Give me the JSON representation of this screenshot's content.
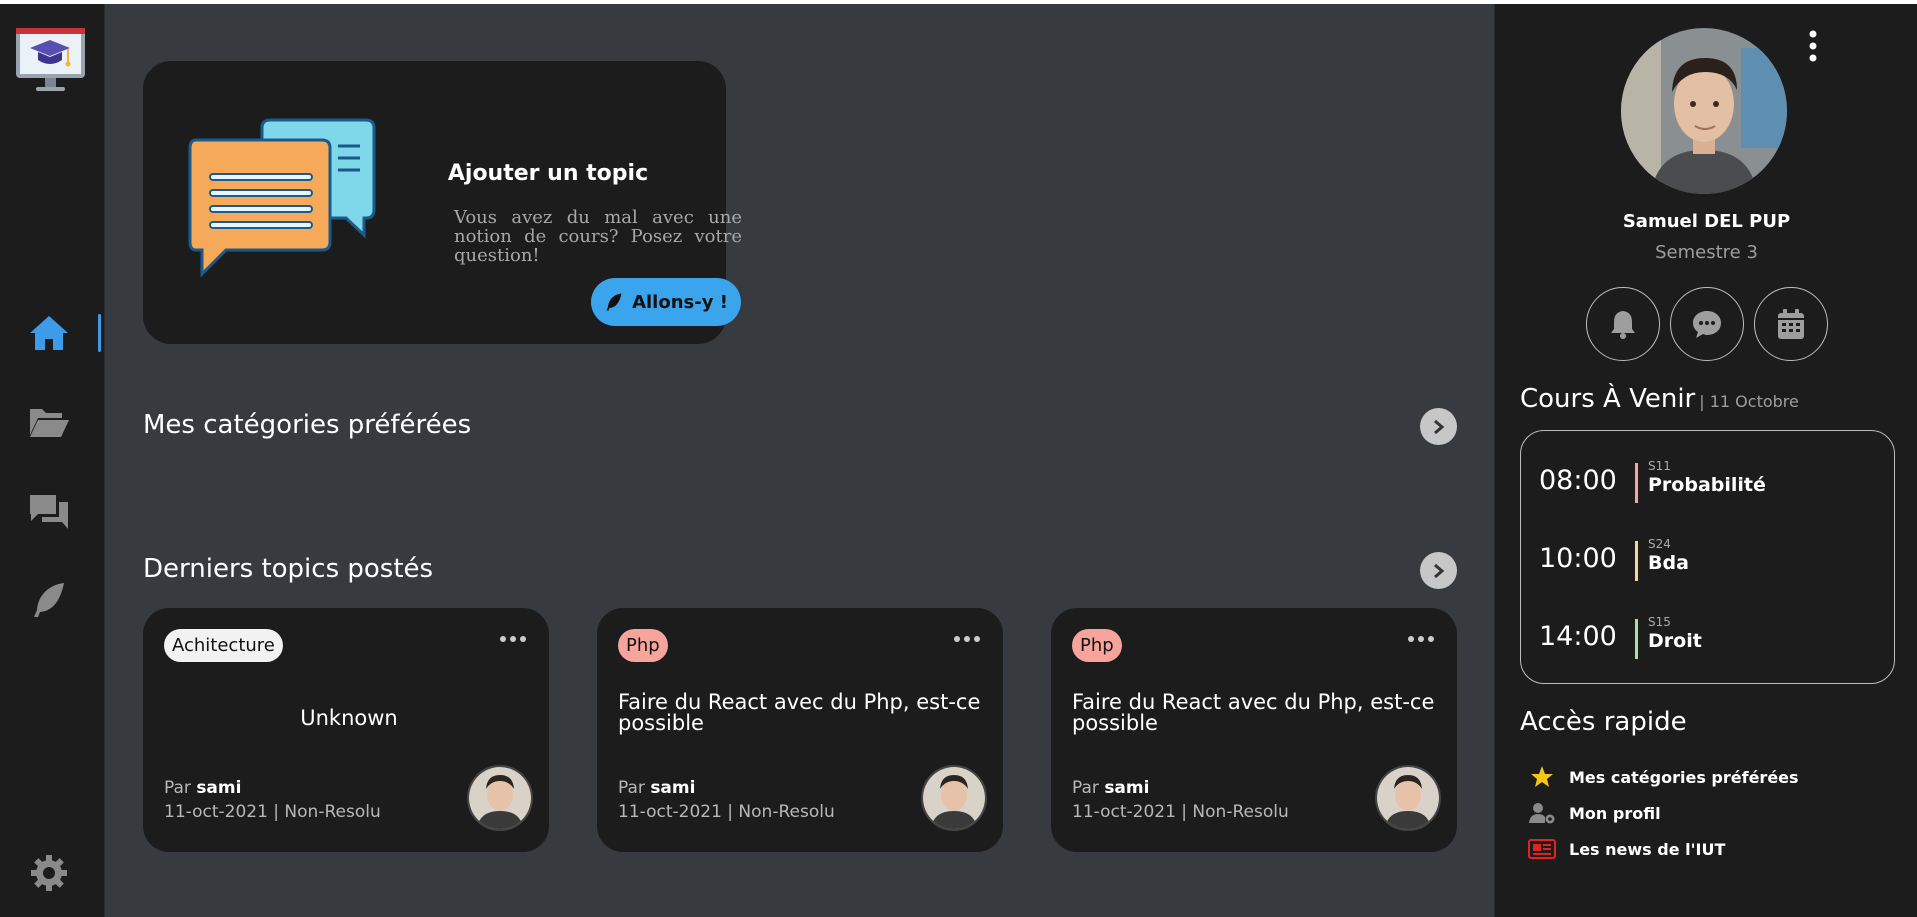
{
  "add_topic": {
    "title": "Ajouter un topic",
    "description": "Vous avez du mal avec une notion de cours? Posez votre question!",
    "button_label": "Allons-y !"
  },
  "sections": {
    "favorites": "Mes catégories préférées",
    "latest": "Derniers topics postés"
  },
  "topics": [
    {
      "tag": "Achitecture",
      "tag_color": "#f2f2f2",
      "title": "Unknown",
      "by_prefix": "Par",
      "author": "sami",
      "info": "11-oct-2021 | Non-Resolu"
    },
    {
      "tag": "Php",
      "tag_color": "#f6a49c",
      "title": "Faire du React avec du Php, est-ce possible",
      "by_prefix": "Par",
      "author": "sami",
      "info": "11-oct-2021 | Non-Resolu"
    },
    {
      "tag": "Php",
      "tag_color": "#f6a49c",
      "title": "Faire du React avec du Php, est-ce possible",
      "by_prefix": "Par",
      "author": "sami",
      "info": "11-oct-2021 | Non-Resolu"
    }
  ],
  "profile": {
    "name": "Samuel DEL PUP",
    "semester": "Semestre 3"
  },
  "courses": {
    "title": "Cours À Venir",
    "date": "| 11 Octobre",
    "items": [
      {
        "time": "08:00",
        "room": "S11",
        "name": "Probabilité",
        "color": "#f4a7a0"
      },
      {
        "time": "10:00",
        "room": "S24",
        "name": "Bda",
        "color": "#f4d7a0"
      },
      {
        "time": "14:00",
        "room": "S15",
        "name": "Droit",
        "color": "#a9e0a6"
      }
    ]
  },
  "quick_access": {
    "title": "Accès rapide",
    "items": [
      {
        "label": "Mes catégories préférées",
        "icon": "star-icon"
      },
      {
        "label": "Mon profil",
        "icon": "user-gear-icon"
      },
      {
        "label": "Les news de l'IUT",
        "icon": "newspaper-icon"
      }
    ]
  },
  "colors": {
    "accent": "#3aa4ec",
    "card": "#1c1c1d",
    "background": "#373a3f"
  }
}
